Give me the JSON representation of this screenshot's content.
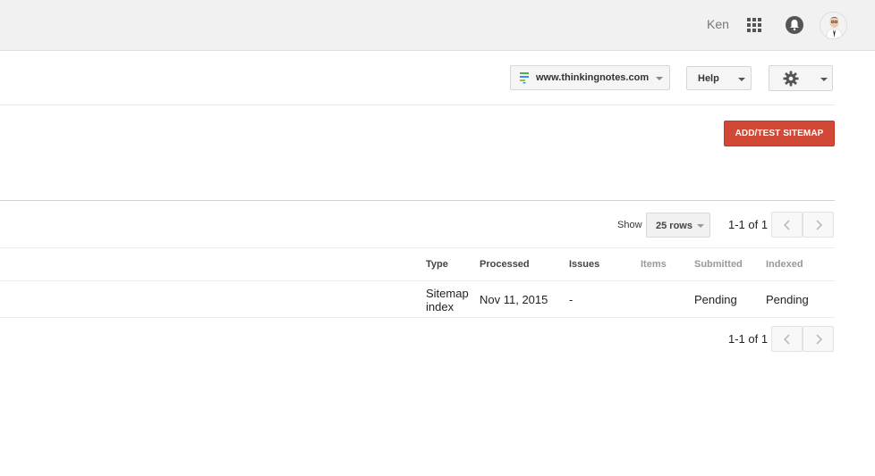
{
  "header": {
    "user_name": "Ken",
    "apps_icon": "apps-grid-icon",
    "notifications_icon": "bell-icon",
    "avatar_icon": "avatar-icon"
  },
  "toolbar": {
    "site_selector": {
      "label": "www.thinkingnotes.com",
      "icon": "site-properties-icon"
    },
    "help_label": "Help",
    "settings_icon": "gear-icon"
  },
  "actions": {
    "add_test_sitemap": "ADD/TEST SITEMAP"
  },
  "pagination": {
    "show_label": "Show",
    "rows_option": "25 rows",
    "range_text": "1-1 of 1",
    "prev_icon": "chevron-left-icon",
    "next_icon": "chevron-right-icon"
  },
  "table": {
    "columns": [
      "Type",
      "Processed",
      "Issues",
      "Items",
      "Submitted",
      "Indexed"
    ],
    "rows": [
      {
        "type_line1": "Sitemap",
        "type_line2": "index",
        "processed": "Nov 11, 2015",
        "issues": "-",
        "items": "",
        "submitted": "Pending",
        "indexed": "Pending"
      }
    ]
  },
  "colors": {
    "accent_red": "#d14836",
    "topbar_bg": "#f1f1f1"
  }
}
